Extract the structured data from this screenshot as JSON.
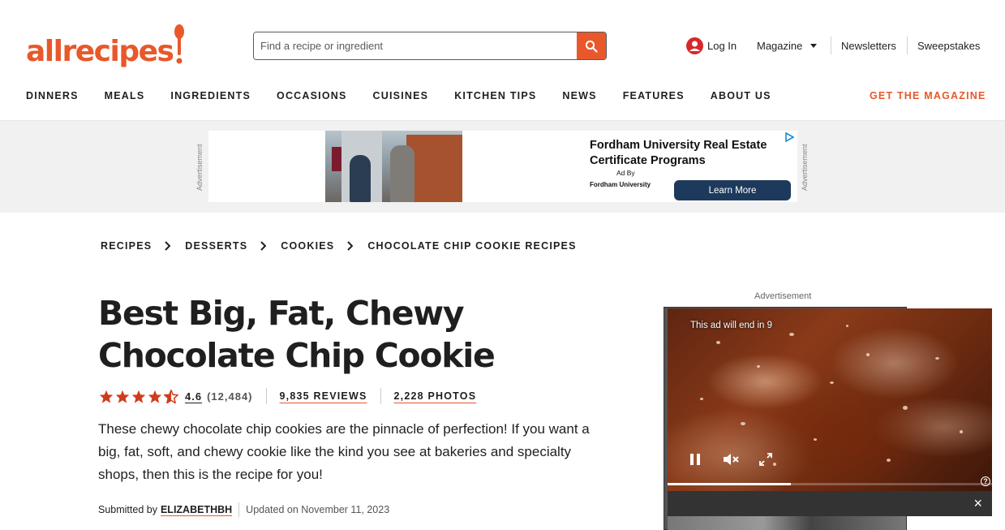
{
  "brand": {
    "logo_text": "allrecipes",
    "accent": "#e8582a"
  },
  "search": {
    "placeholder": "Find a recipe or ingredient"
  },
  "utility": {
    "login": "Log In",
    "magazine": "Magazine",
    "newsletters": "Newsletters",
    "sweepstakes": "Sweepstakes"
  },
  "nav": {
    "items": [
      "DINNERS",
      "MEALS",
      "INGREDIENTS",
      "OCCASIONS",
      "CUISINES",
      "KITCHEN TIPS",
      "NEWS",
      "FEATURES",
      "ABOUT US"
    ],
    "cta": "GET THE MAGAZINE"
  },
  "top_ad": {
    "label": "Advertisement",
    "title": "Fordham University Real Estate Certificate Programs",
    "ad_by": "Ad By",
    "advertiser": "Fordham University",
    "button": "Learn More"
  },
  "breadcrumb": [
    "RECIPES",
    "DESSERTS",
    "COOKIES",
    "CHOCOLATE CHIP COOKIE RECIPES"
  ],
  "recipe": {
    "title": "Best Big, Fat, Chewy Chocolate Chip Cookie",
    "rating": "4.6",
    "rating_value": 4.6,
    "rating_count": "(12,484)",
    "reviews": "9,835 REVIEWS",
    "photos": "2,228 PHOTOS",
    "description": "These chewy chocolate chip cookies are the pinnacle of perfection! If you want a big, fat, soft, and chewy cookie like the kind you see at bakeries and specialty shops, then this is the recipe for you!",
    "submitted_label": "Submitted by",
    "author": "ELIZABETHBH",
    "updated": "Updated on November 11, 2023"
  },
  "side_ad": {
    "label": "Advertisement",
    "countdown": "This ad will end in 9",
    "progress": 0.38,
    "close": "×",
    "help": "?"
  }
}
